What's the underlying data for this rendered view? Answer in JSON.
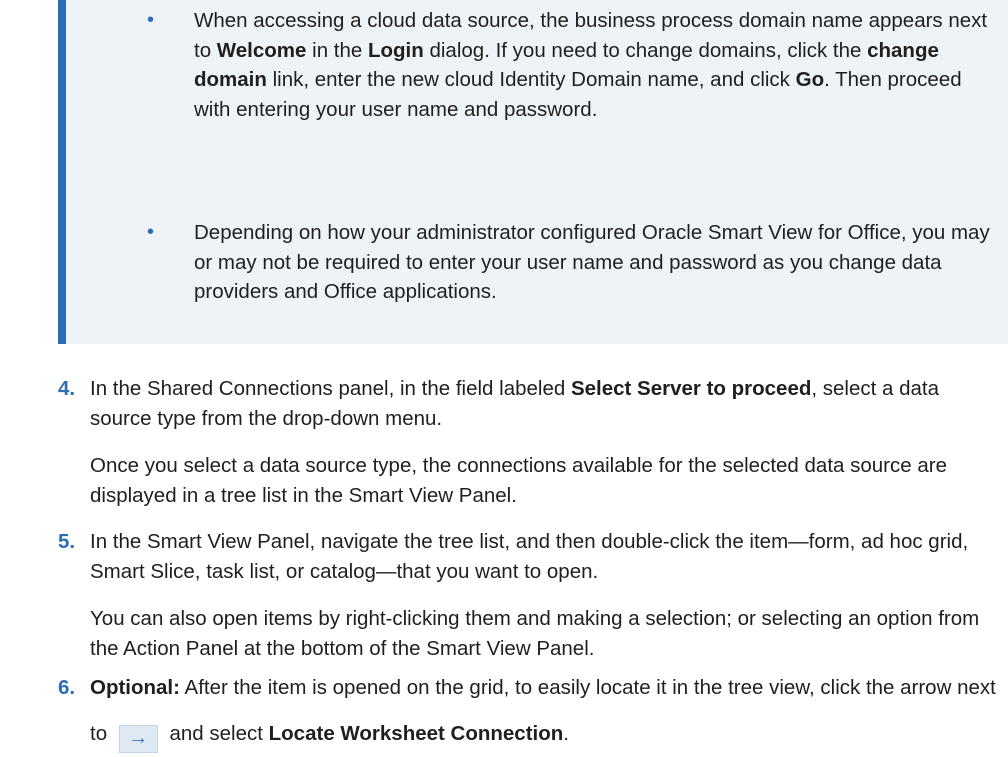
{
  "note": {
    "bullet1": {
      "t1": "When accessing a cloud data source, the business process domain name appears next to ",
      "b1": "Welcome",
      "t2": " in the ",
      "b2": "Login",
      "t3": " dialog. If you need to change domains, click the ",
      "b3": "change domain",
      "t4": " link, enter the new cloud Identity Domain name, and click ",
      "b4": "Go",
      "t5": ". Then proceed with entering your user name and password."
    },
    "bullet2": "Depending on how your administrator configured Oracle Smart View for Office, you may or may not be required to enter your user name and password as you change data providers and Office applications.",
    "bullet_glyph": "•"
  },
  "steps": {
    "s4": {
      "num": "4.",
      "t1": "In the Shared Connections panel, in the field labeled ",
      "b1": "Select Server to proceed",
      "t2": ", select a data source type from the drop-down menu.",
      "para": "Once you select a data source type, the connections available for the selected data source are displayed in a tree list in the Smart View Panel."
    },
    "s5": {
      "num": "5.",
      "text": "In the Smart View Panel, navigate the tree list, and then double-click the item—form, ad hoc grid, Smart Slice, task list, or catalog—that you want to open.",
      "para": "You can also open items by right-clicking them and making a selection; or selecting an option from the Action Panel at the bottom of the Smart View Panel."
    },
    "s6": {
      "num": "6.",
      "b1": "Optional:",
      "t1": " After the item is opened on the grid, to easily locate it in the tree view, click the arrow next to ",
      "icon": "→",
      "t2": " and select ",
      "b2": "Locate Worksheet Connection",
      "t3": "."
    }
  },
  "colors": {
    "accent": "#2d6db5",
    "note_bg": "#eef3f8",
    "text": "#1f1f1f"
  }
}
